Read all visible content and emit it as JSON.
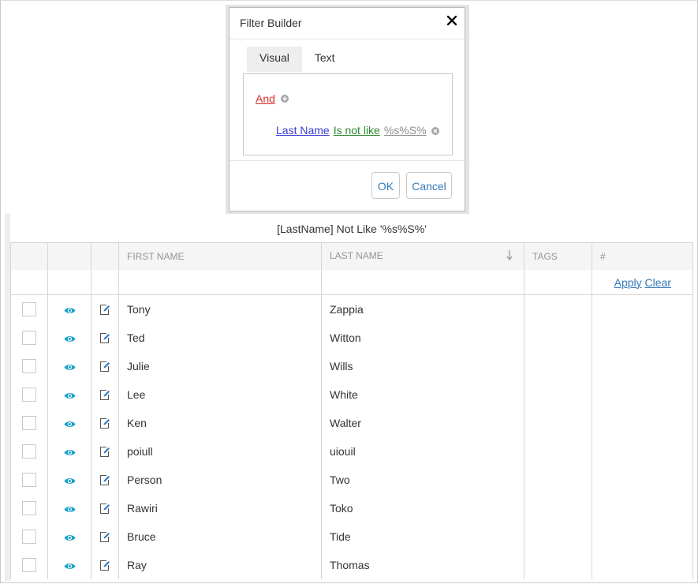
{
  "dialog": {
    "title": "Filter Builder",
    "tabs": [
      {
        "label": "Visual",
        "active": true
      },
      {
        "label": "Text",
        "active": false
      }
    ],
    "group_operation": "And",
    "condition": {
      "field": "Last Name",
      "operation": "Is not like",
      "value": "%s%S%"
    },
    "ok_label": "OK",
    "cancel_label": "Cancel"
  },
  "filter_expression": "[LastName] Not Like '%s%S%'",
  "grid": {
    "columns": {
      "first_name": "FIRST NAME",
      "last_name": "LAST NAME",
      "tags": "TAGS",
      "number": "#"
    },
    "sort": {
      "column": "last_name",
      "direction": "descending"
    },
    "filter_row": {
      "apply_label": "Apply",
      "clear_label": "Clear"
    },
    "rows": [
      {
        "first_name": "Tony",
        "last_name": "Zappia"
      },
      {
        "first_name": "Ted",
        "last_name": "Witton"
      },
      {
        "first_name": "Julie",
        "last_name": "Wills"
      },
      {
        "first_name": "Lee",
        "last_name": "White"
      },
      {
        "first_name": "Ken",
        "last_name": "Walter"
      },
      {
        "first_name": "poiull",
        "last_name": "uiouil"
      },
      {
        "first_name": "Person",
        "last_name": "Two"
      },
      {
        "first_name": "Rawiri",
        "last_name": "Toko"
      },
      {
        "first_name": "Bruce",
        "last_name": "Tide"
      },
      {
        "first_name": "Ray",
        "last_name": "Thomas"
      }
    ]
  },
  "icons": {
    "view": "eye-icon",
    "edit": "edit-icon",
    "sort": "arrow-down-icon",
    "close": "close-icon",
    "add": "plus-circle-icon",
    "remove": "x-circle-icon"
  },
  "colors": {
    "accent": "#337ab7",
    "eye": "#1aa1c8",
    "group_op": "#d9302b",
    "field": "#3c3cd0",
    "operation": "#2c8a2c",
    "value": "#8f8f8f"
  }
}
